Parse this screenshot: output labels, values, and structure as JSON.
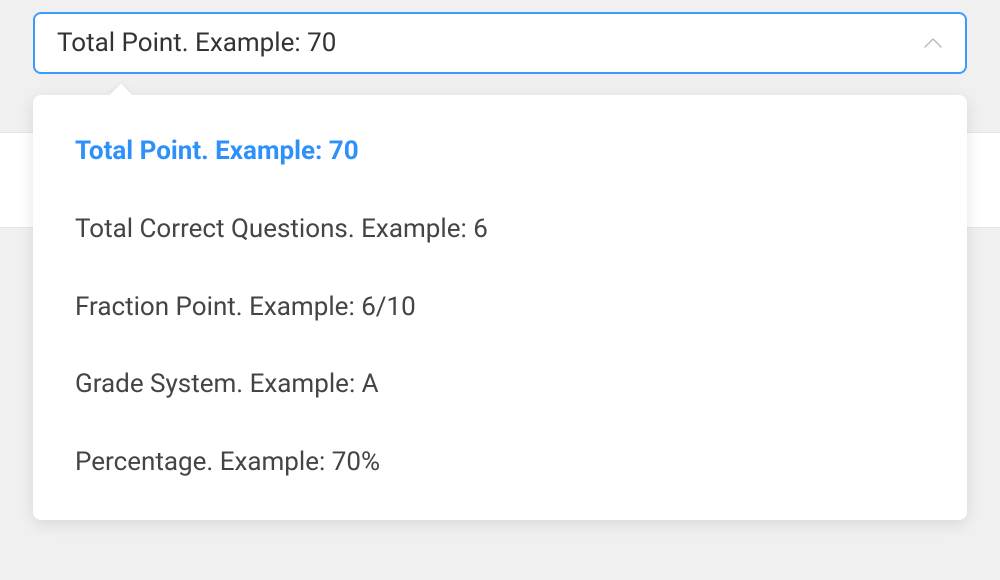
{
  "select": {
    "selected_label": "Total Point. Example: 70",
    "options": [
      {
        "label": "Total Point. Example: 70",
        "selected": true
      },
      {
        "label": "Total Correct Questions. Example: 6",
        "selected": false
      },
      {
        "label": "Fraction Point. Example: 6/10",
        "selected": false
      },
      {
        "label": "Grade System. Example: A",
        "selected": false
      },
      {
        "label": "Percentage. Example: 70%",
        "selected": false
      }
    ]
  }
}
